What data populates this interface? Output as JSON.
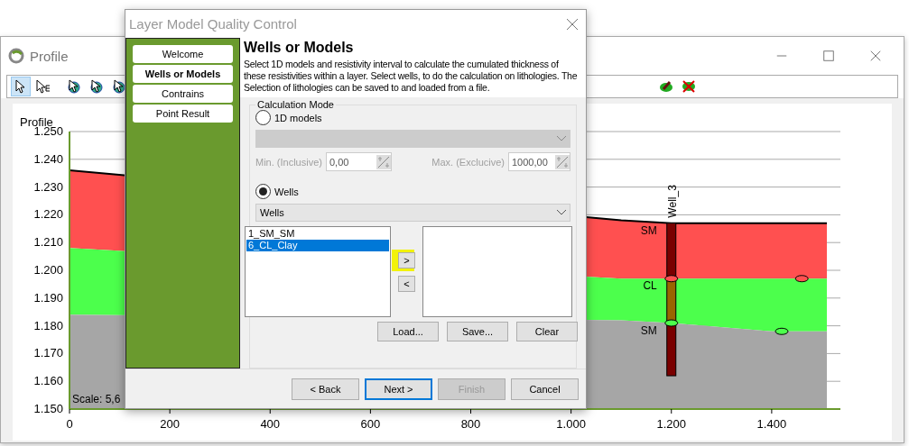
{
  "profile_window": {
    "title": "Profile",
    "toolbar": {
      "tools": [
        {
          "kind": "pointer",
          "selected": true
        },
        {
          "kind": "pointer-list",
          "selected": false
        },
        {
          "kind": "cursor",
          "selected": false
        },
        {
          "kind": "cursor",
          "selected": false
        },
        {
          "kind": "cursor",
          "selected": false
        },
        {
          "kind": "edit",
          "selected": false
        },
        {
          "kind": "delete",
          "selected": false
        }
      ]
    },
    "chart": {
      "scale": "Scale: 5,6",
      "well": {
        "labels": [
          "SM",
          "CL",
          "SM"
        ]
      },
      "chart_data": {
        "type": "area",
        "ylabel": "Profile",
        "stacked": false,
        "x": [
          0,
          1100,
          1200,
          1400,
          1420,
          1460,
          1510
        ],
        "series": [
          {
            "color": "#ff5050",
            "values": [
              1236,
              1218,
              1217,
              1217,
              1217,
              1217,
              1217
            ]
          },
          {
            "color": "#4cff4c",
            "values": [
              1208,
              1197,
              1197,
              1197,
              1197,
              1197,
              1197
            ]
          },
          {
            "color": "#a6a6a6",
            "values": [
              1184,
              1182,
              1181,
              1178,
              1178,
              1178,
              1178
            ]
          }
        ],
        "grid": true,
        "xlim": [
          0,
          1537
        ],
        "ylim": [
          1150,
          1250
        ],
        "annotations": [
          {
            "x": 1200,
            "y": 1217,
            "text": "Well_3"
          }
        ],
        "xticks": [
          {
            "value": 0,
            "label": "0"
          },
          {
            "value": 200,
            "label": "200"
          },
          {
            "value": 400,
            "label": "400"
          },
          {
            "value": 600,
            "label": "600"
          },
          {
            "value": 800,
            "label": "800"
          },
          {
            "value": 1000,
            "label": "1.000"
          },
          {
            "value": 1200,
            "label": "1.200"
          },
          {
            "value": 1400,
            "label": "1.400"
          }
        ],
        "yticks": [
          {
            "value": 1150,
            "label": "1.150"
          },
          {
            "value": 1160,
            "label": "1.160"
          },
          {
            "value": 1170,
            "label": "1.170"
          },
          {
            "value": 1180,
            "label": "1.180"
          },
          {
            "value": 1190,
            "label": "1.190"
          },
          {
            "value": 1200,
            "label": "1.200"
          },
          {
            "value": 1210,
            "label": "1.210"
          },
          {
            "value": 1220,
            "label": "1.220"
          },
          {
            "value": 1230,
            "label": "1.230"
          },
          {
            "value": 1240,
            "label": "1.240"
          },
          {
            "value": 1250,
            "label": "1.250"
          }
        ]
      }
    }
  },
  "dialog": {
    "title": "Layer Model Quality Control",
    "steps": [
      {
        "label": "Welcome",
        "selected": false
      },
      {
        "label": "Wells or Models",
        "selected": true
      },
      {
        "label": "Contrains",
        "selected": false
      },
      {
        "label": "Point Result",
        "selected": false
      }
    ],
    "heading": "Wells or Models",
    "description": "Select 1D models and resistivity interval to calculate the cumulated thickness of these resistivities within a layer. Select wells, to do the calculation on lithologies. The Selection of lithologies can be saved to and loaded from a file.",
    "group": {
      "legend": "Calculation Mode",
      "models_option": {
        "label": "1D models",
        "selected": false
      },
      "min": {
        "label": "Min. (Inclusive)",
        "value": "0,00",
        "disabled": true
      },
      "max": {
        "label": "Max. (Exclucive)",
        "value": "1000,00",
        "disabled": true
      },
      "wells_option": {
        "label": "Wells",
        "selected": true
      },
      "wells_select": {
        "value": "Wells"
      },
      "available": [
        {
          "label": "1_SM_SM",
          "selected": false
        },
        {
          "label": "6_CL_Clay",
          "selected": true
        }
      ],
      "move_buttons": [
        {
          "label": ">",
          "highlighted": true
        },
        {
          "label": "<",
          "highlighted": false
        }
      ],
      "file_buttons": [
        "Load...",
        "Save...",
        "Clear"
      ]
    },
    "footer": [
      {
        "label": "< Back",
        "disabled": false,
        "focused": false
      },
      {
        "label": "Next >",
        "disabled": false,
        "focused": true
      },
      {
        "label": "Finish",
        "disabled": true,
        "focused": false
      },
      {
        "label": "Cancel",
        "disabled": false,
        "focused": false
      }
    ]
  }
}
